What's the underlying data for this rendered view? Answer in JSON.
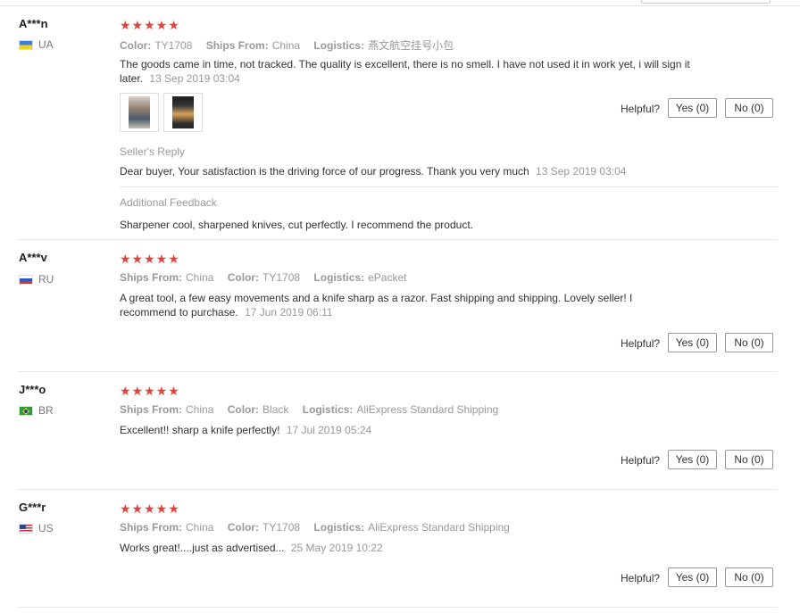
{
  "helpful_label": "Helpful?",
  "reviews": [
    {
      "user": "A***n",
      "country": "UA",
      "flag_icon": "ukraine-flag-icon",
      "stars": "★★★★★",
      "attr1_label": "Color:",
      "attr1_value": "TY1708",
      "attr2_label": "Ships From:",
      "attr2_value": "China",
      "attr3_label": "Logistics:",
      "attr3_value": "燕文航空挂号小包",
      "text": "The goods came in time, not tracked. The quality is excellent, there is no smell. I have not used it in work yet, i will sign it later.",
      "date": "13 Sep 2019 03:04",
      "yes": "Yes (0)",
      "no": "No (0)",
      "seller_reply_title": "Seller's Reply",
      "seller_reply_text": "Dear buyer, Your satisfaction is the driving force of our progress. Thank you very much",
      "seller_reply_date": "13 Sep 2019 03:04",
      "additional_title": "Additional Feedback",
      "additional_text": "Sharpener cool, sharpened knives, cut perfectly. I recommend the product."
    },
    {
      "user": "A***v",
      "country": "RU",
      "flag_icon": "russia-flag-icon",
      "stars": "★★★★★",
      "attr1_label": "Ships From:",
      "attr1_value": "China",
      "attr2_label": "Color:",
      "attr2_value": "TY1708",
      "attr3_label": "Logistics:",
      "attr3_value": "ePacket",
      "text": "A great tool, a few easy movements and a knife sharp as a razor. Fast shipping and shipping. Lovely seller! I recommend to purchase.",
      "date": "17 Jun 2019 06:11",
      "yes": "Yes (0)",
      "no": "No (0)"
    },
    {
      "user": "J***o",
      "country": "BR",
      "flag_icon": "brazil-flag-icon",
      "stars": "★★★★★",
      "attr1_label": "Ships From:",
      "attr1_value": "China",
      "attr2_label": "Color:",
      "attr2_value": "Black",
      "attr3_label": "Logistics:",
      "attr3_value": "AliExpress Standard Shipping",
      "text": "Excellent!! sharp a knife perfectly!",
      "date": "17 Jul 2019 05:24",
      "yes": "Yes (0)",
      "no": "No (0)"
    },
    {
      "user": "G***r",
      "country": "US",
      "flag_icon": "usa-flag-icon",
      "stars": "★★★★★",
      "attr1_label": "Ships From:",
      "attr1_value": "China",
      "attr2_label": "Color:",
      "attr2_value": "TY1708",
      "attr3_label": "Logistics:",
      "attr3_value": "AliExpress Standard Shipping",
      "text": "Works great!....just as advertised...",
      "date": "25 May 2019 10:22",
      "yes": "Yes (0)",
      "no": "No (0)"
    }
  ],
  "colors": {
    "star": "#e0443c",
    "muted": "#999999",
    "text": "#333333"
  }
}
